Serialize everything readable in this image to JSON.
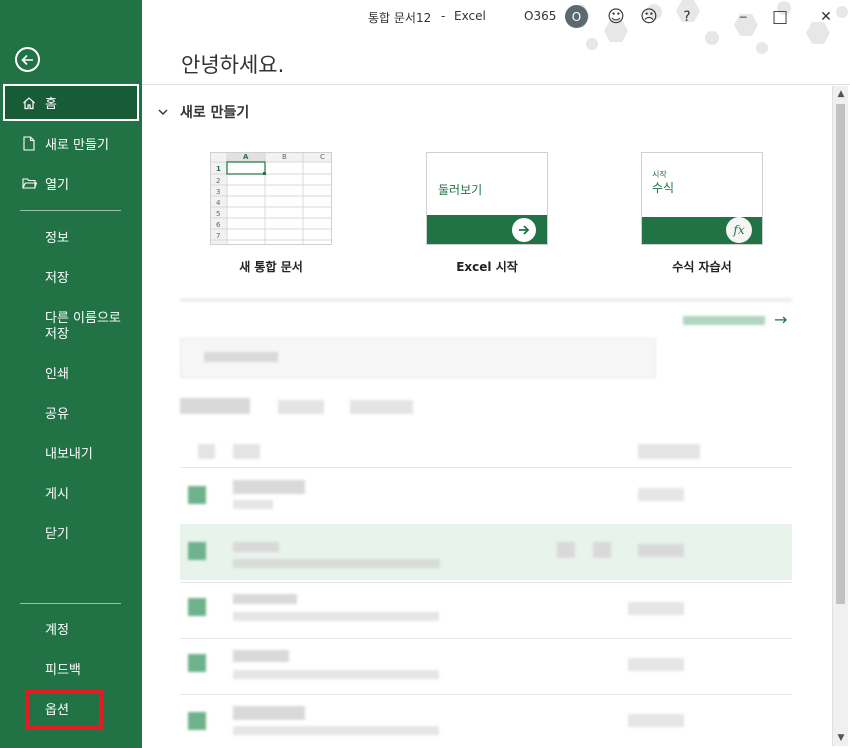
{
  "window": {
    "title": "통합 문서12",
    "app": "Excel",
    "separator": "-",
    "account": "O365",
    "avatar_initial": "O",
    "buttons": {
      "smile": "☺",
      "frown": "☹",
      "help": "?",
      "minimize": "─",
      "maximize": "□",
      "close": "✕"
    }
  },
  "sidebar": {
    "bg_color": "#217346",
    "home_label": "홈",
    "new_label": "새로 만들기",
    "open_label": "열기",
    "info_label": "정보",
    "save_label": "저장",
    "saveas_line1": "다른 이름으로",
    "saveas_line2": "저장",
    "print_label": "인쇄",
    "share_label": "공유",
    "export_label": "내보내기",
    "publish_label": "게시",
    "close_label": "닫기",
    "account_label": "계정",
    "feedback_label": "피드백",
    "options_label": "옵션"
  },
  "main": {
    "greeting": "안녕하세요.",
    "new_section_title": "새로 만들기",
    "templates": [
      {
        "label": "새 통합 문서"
      },
      {
        "label": "Excel 시작",
        "card_text": "둘러보기"
      },
      {
        "label": "수식 자습서",
        "card_small": "시작",
        "card_text": "수식",
        "fx": "fx"
      }
    ],
    "grid": {
      "cols": [
        "A",
        "B",
        "C"
      ],
      "rows": [
        "1",
        "2",
        "3",
        "4",
        "5",
        "6",
        "7"
      ]
    },
    "more_arrow": "→"
  },
  "scrollbar": {
    "up": "▲",
    "down": "▼"
  }
}
